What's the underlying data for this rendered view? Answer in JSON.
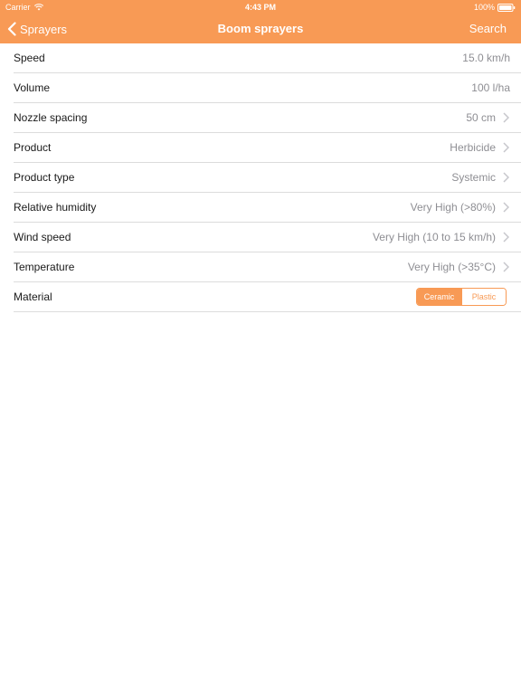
{
  "status_bar": {
    "carrier": "Carrier",
    "time": "4:43 PM",
    "battery": "100%"
  },
  "nav": {
    "back_label": "Sprayers",
    "title": "Boom sprayers",
    "search_label": "Search"
  },
  "rows": [
    {
      "label": "Speed",
      "value": "15.0 km/h",
      "chevron": false
    },
    {
      "label": "Volume",
      "value": "100 l/ha",
      "chevron": false
    },
    {
      "label": "Nozzle spacing",
      "value": "50 cm",
      "chevron": true
    },
    {
      "label": "Product",
      "value": "Herbicide",
      "chevron": true
    },
    {
      "label": "Product type",
      "value": "Systemic",
      "chevron": true
    },
    {
      "label": "Relative humidity",
      "value": "Very High (>80%)",
      "chevron": true
    },
    {
      "label": "Wind speed",
      "value": "Very High (10 to 15 km/h)",
      "chevron": true
    },
    {
      "label": "Temperature",
      "value": "Very High (>35°C)",
      "chevron": true
    }
  ],
  "material": {
    "label": "Material",
    "options": [
      "Ceramic",
      "Plastic"
    ],
    "selected": "Ceramic"
  },
  "colors": {
    "accent": "#f89a55",
    "separator": "#dcdcdc",
    "value_text": "#8e8e93"
  },
  "icons": {
    "wifi": "wifi-icon",
    "battery": "battery-icon",
    "back": "chevron-left-icon",
    "row_disclosure": "chevron-right-icon"
  }
}
